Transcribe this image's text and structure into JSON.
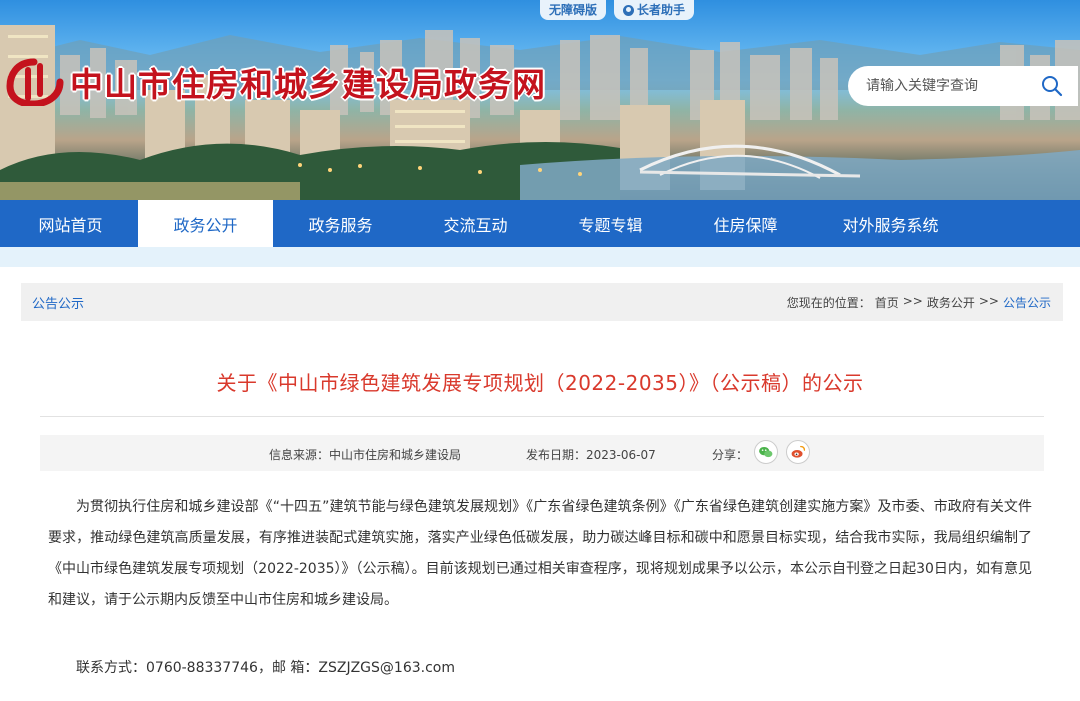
{
  "accessibility": {
    "barrier_free": "无障碍版",
    "elder_helper": "长者助手"
  },
  "site": {
    "title": "中山市住房和城乡建设局政务网"
  },
  "search": {
    "placeholder": "请输入关键字查询"
  },
  "nav": {
    "items": [
      {
        "label": "网站首页"
      },
      {
        "label": "政务公开"
      },
      {
        "label": "政务服务"
      },
      {
        "label": "交流互动"
      },
      {
        "label": "专题专辑"
      },
      {
        "label": "住房保障"
      },
      {
        "label": "对外服务系统"
      }
    ],
    "active": "政务公开"
  },
  "breadcrumb": {
    "section": "公告公示",
    "prefix": "您现在的位置：",
    "home": "首页",
    "sep": ">>",
    "level1": "政务公开",
    "current": "公告公示"
  },
  "article": {
    "title": "关于《中山市绿色建筑发展专项规划（2022-2035）》（公示稿）的公示",
    "source_label": "信息来源：中山市住房和城乡建设局",
    "date_label": "发布日期：2023-06-07",
    "share_label": "分享：",
    "body": "为贯彻执行住房和城乡建设部《“十四五”建筑节能与绿色建筑发展规划》《广东省绿色建筑条例》《广东省绿色建筑创建实施方案》及市委、市政府有关文件要求，推动绿色建筑高质量发展，有序推进装配式建筑实施，落实产业绿色低碳发展，助力碳达峰目标和碳中和愿景目标实现，结合我市实际，我局组织编制了《中山市绿色建筑发展专项规划（2022-2035）》（公示稿）。目前该规划已通过相关审查程序，现将规划成果予以公示，本公示自刊登之日起30日内，如有意见和建议，请于公示期内反馈至中山市住房和城乡建设局。",
    "contact": "联系方式：0760-88337746，邮 箱：ZSZJZGS@163.com"
  },
  "colors": {
    "nav_blue": "#1f68c6",
    "title_red": "#d9392c",
    "logo_red": "#c4121d"
  },
  "icons": [
    "search-icon",
    "wechat-icon",
    "weibo-icon",
    "logo-icon",
    "elder-helper-icon"
  ]
}
